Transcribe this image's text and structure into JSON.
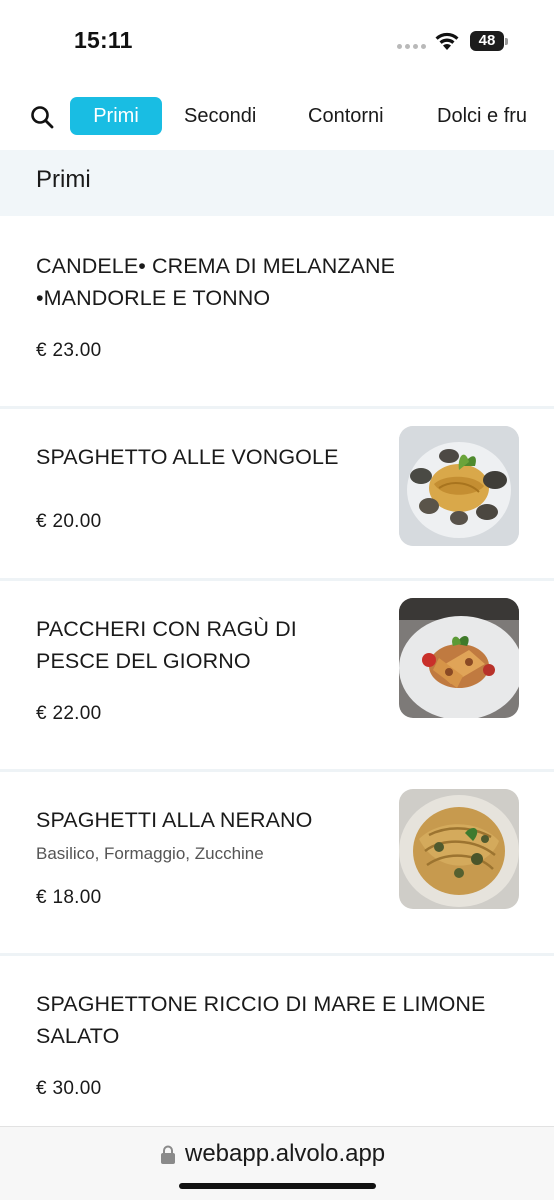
{
  "status_bar": {
    "time": "15:11",
    "battery": "48",
    "battery_level": 0.48
  },
  "tabs": [
    {
      "label": "Primi",
      "active": true
    },
    {
      "label": "Secondi",
      "active": false
    },
    {
      "label": "Contorni",
      "active": false
    },
    {
      "label": "Dolci e fru",
      "active": false
    }
  ],
  "section": {
    "title": "Primi"
  },
  "items": [
    {
      "name": "CANDELE• CREMA DI MELANZANE •MANDORLE E TONNO",
      "description": "",
      "price": "€ 23.00",
      "photo": false
    },
    {
      "name": "SPAGHETTO ALLE VONGOLE",
      "description": "",
      "price": "€ 20.00",
      "photo": true
    },
    {
      "name": "PACCHERI CON RAGÙ DI PESCE DEL GIORNO",
      "description": "",
      "price": "€ 22.00",
      "photo": true
    },
    {
      "name": "SPAGHETTI ALLA NERANO",
      "description": "Basilico, Formaggio, Zucchine",
      "price": "€ 18.00",
      "photo": true
    },
    {
      "name": "SPAGHETTONE RICCIO DI MARE E LIMONE SALATO",
      "description": "",
      "price": "€ 30.00",
      "photo": false
    }
  ],
  "url_bar": {
    "url": "webapp.alvolo.app"
  },
  "colors": {
    "accent": "#19bde3",
    "section_bg": "#f1f6f9"
  },
  "icons": [
    "search-icon",
    "wifi-icon",
    "battery-icon",
    "lock-icon"
  ]
}
